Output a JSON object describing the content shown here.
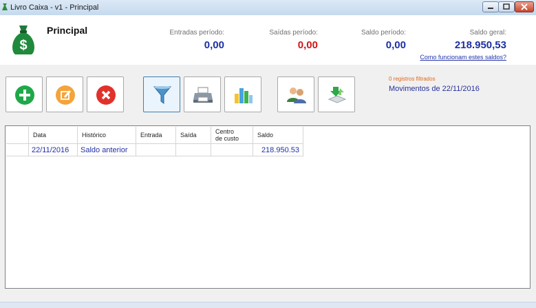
{
  "window": {
    "title": "Livro Caixa - v1 - Principal"
  },
  "header": {
    "title": "Principal"
  },
  "stats": [
    {
      "label": "Entradas período:",
      "value": "0,00",
      "color": "#1c2fa3"
    },
    {
      "label": "Saídas período:",
      "value": "0,00",
      "color": "#d41414"
    },
    {
      "label": "Saldo período:",
      "value": "0,00",
      "color": "#1c2fa3"
    },
    {
      "label": "Saldo geral:",
      "value": "218.950,53",
      "color": "#1c2fa3"
    }
  ],
  "help_link": "Como funcionam estes saldos?",
  "toolbar": {
    "buttons": [
      {
        "icon": "add-icon"
      },
      {
        "icon": "edit-icon"
      },
      {
        "icon": "delete-icon"
      },
      {
        "icon": "filter-icon"
      },
      {
        "icon": "print-icon"
      },
      {
        "icon": "chart-icon"
      },
      {
        "icon": "users-icon"
      },
      {
        "icon": "sync-icon"
      }
    ]
  },
  "info": {
    "filtered": "0 registros filtrados",
    "movements": "Movimentos de 22/11/2016"
  },
  "grid": {
    "columns": [
      "Data",
      "Histórico",
      "Entrada",
      "Saída",
      "Centro de custo",
      "Saldo"
    ],
    "rows": [
      {
        "data": "22/11/2016",
        "historico": "Saldo anterior",
        "entrada": "",
        "saida": "",
        "centro": "",
        "saldo": "218.950.53"
      }
    ]
  }
}
